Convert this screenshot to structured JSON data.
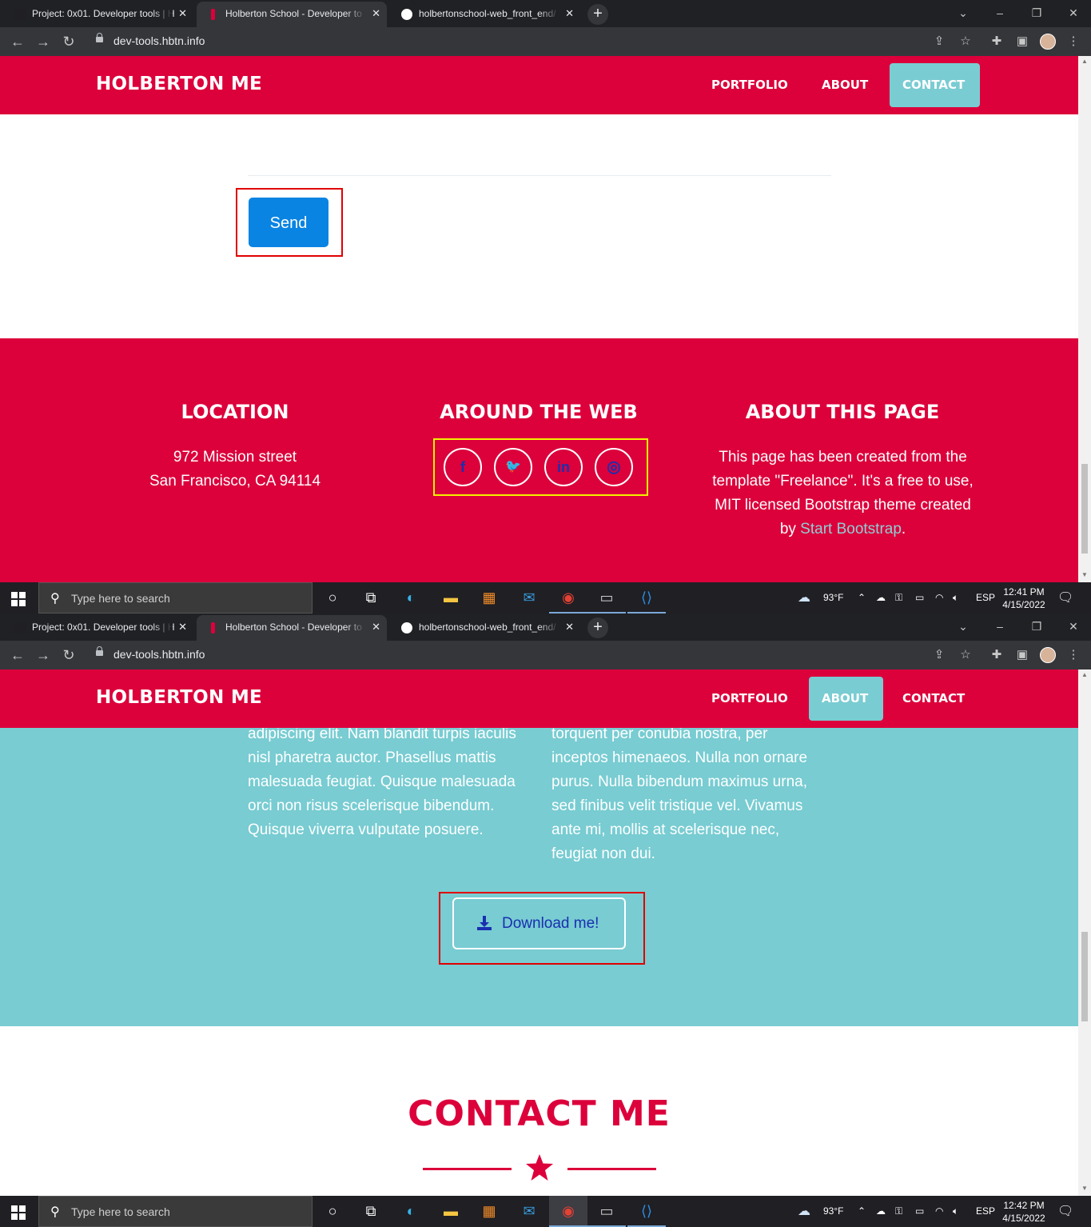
{
  "browser": {
    "tabs": [
      {
        "title": "Project: 0x01. Developer tools | H",
        "favicon_color": "#1f1f24"
      },
      {
        "title": "Holberton School - Developer to",
        "favicon_color": "#dc003b"
      },
      {
        "title": "holbertonschool-web_front_end/",
        "favicon_color": "#ffffff"
      }
    ],
    "url": "dev-tools.hbtn.info"
  },
  "site": {
    "brand": "HOLBERTON ME",
    "nav": [
      "PORTFOLIO",
      "ABOUT",
      "CONTACT"
    ]
  },
  "screenshot1": {
    "active_nav": "CONTACT",
    "send_label": "Send",
    "footer": {
      "location_title": "LOCATION",
      "location_line1": "972 Mission street",
      "location_line2": "San Francisco, CA 94114",
      "web_title": "AROUND THE WEB",
      "social": [
        {
          "icon": "facebook-icon",
          "glyph": "f"
        },
        {
          "icon": "twitter-icon",
          "glyph": "🐦"
        },
        {
          "icon": "linkedin-icon",
          "glyph": "in"
        },
        {
          "icon": "dribbble-icon",
          "glyph": "◎"
        }
      ],
      "about_title": "ABOUT THIS PAGE",
      "about_text_1": "This page has been created from the template \"Freelance\". It's a free to use, MIT licensed Bootstrap theme created by ",
      "about_link": "Start Bootstrap",
      "about_text_2": "."
    },
    "taskbar": {
      "time": "12:41 PM",
      "date": "4/15/2022"
    }
  },
  "screenshot2": {
    "active_nav": "ABOUT",
    "about_left": "adipiscing elit. Nam blandit turpis iaculis nisl pharetra auctor. Phasellus mattis malesuada feugiat. Quisque malesuada orci non risus scelerisque bibendum. Quisque viverra vulputate posuere.",
    "about_right": "torquent per conubia nostra, per inceptos himenaeos. Nulla non ornare purus. Nulla bibendum maximus urna, sed finibus velit tristique vel. Vivamus ante mi, mollis at scelerisque nec, feugiat non dui.",
    "download_label": "Download me!",
    "contact_title": "CONTACT ME",
    "taskbar": {
      "time": "12:42 PM",
      "date": "4/15/2022"
    }
  },
  "taskbar": {
    "search_placeholder": "Type here to search",
    "weather": "93°F",
    "language": "ESP"
  },
  "colors": {
    "primary": "#dc003b",
    "secondary": "#78ccd2",
    "send_button": "#0984e3",
    "social_icon": "#1a2fb0",
    "annotation_red": "#e00000",
    "annotation_yellow": "#f2f200"
  }
}
